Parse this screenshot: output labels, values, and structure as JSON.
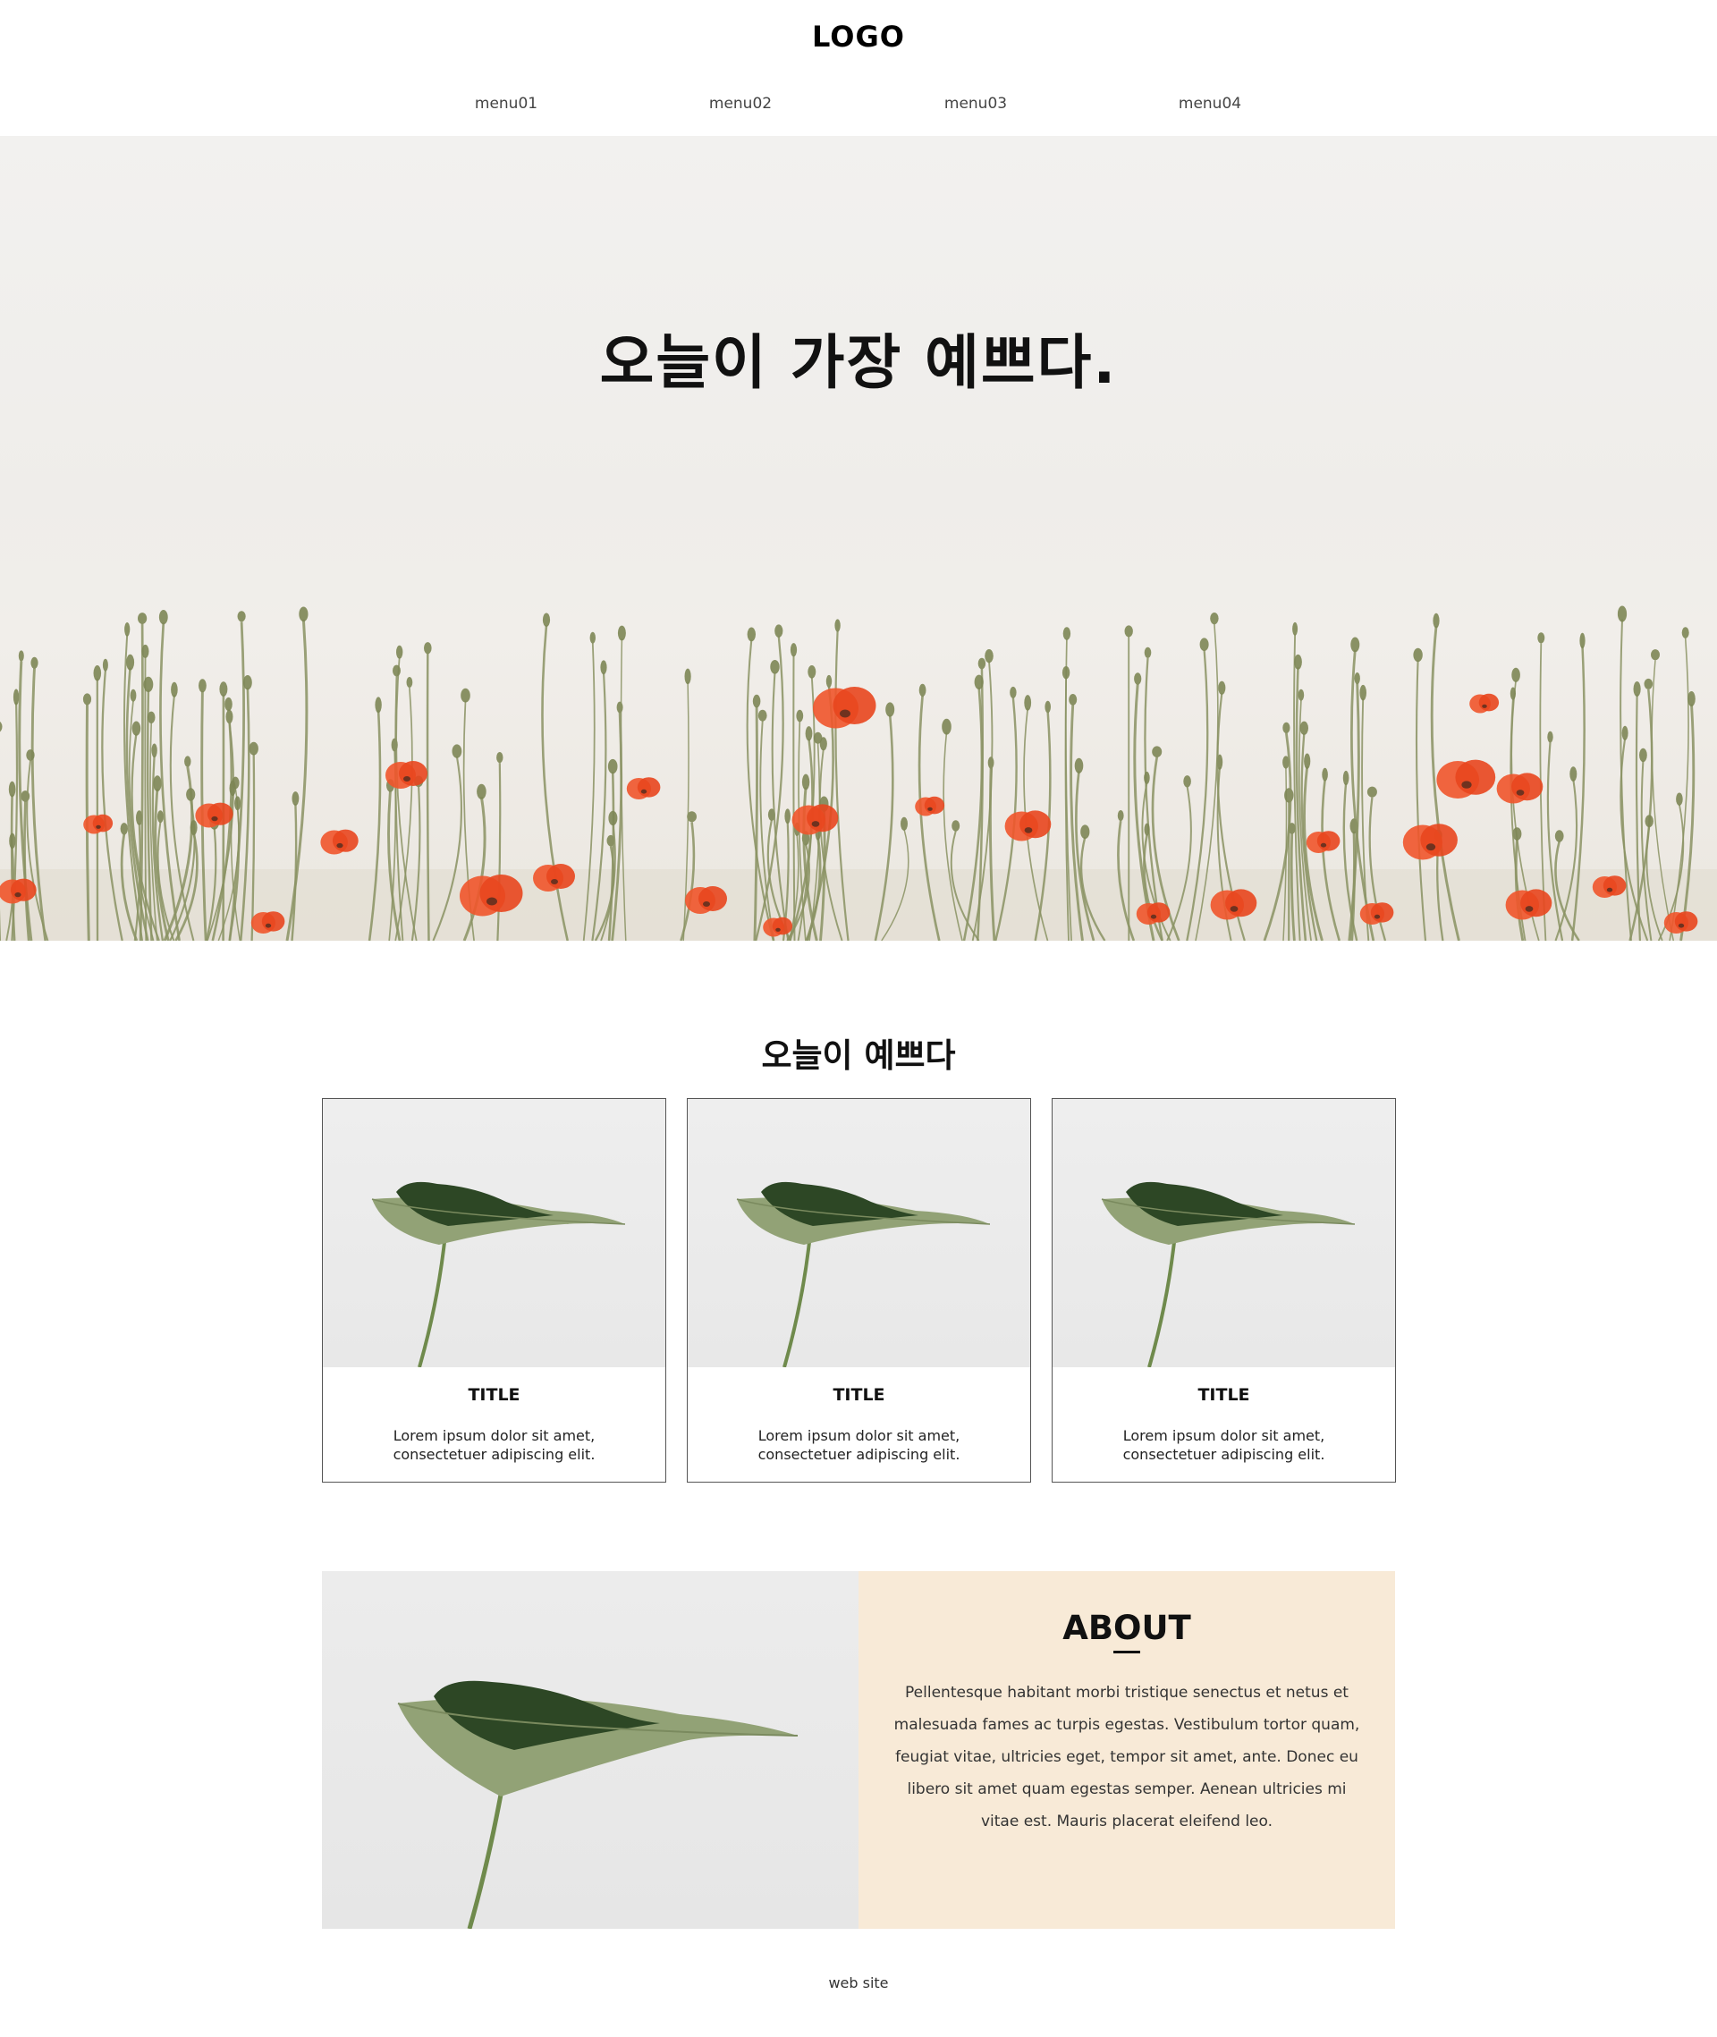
{
  "header": {
    "logo": "LOGO",
    "menu": [
      {
        "label": "menu01"
      },
      {
        "label": "menu02"
      },
      {
        "label": "menu03"
      },
      {
        "label": "menu04"
      }
    ]
  },
  "hero": {
    "title": "오늘이 가장 예쁘다."
  },
  "cards_section": {
    "title": "오늘이 예쁘다",
    "cards": [
      {
        "title": "TITLE",
        "text": "Lorem ipsum dolor sit amet, consectetuer adipiscing elit."
      },
      {
        "title": "TITLE",
        "text": "Lorem ipsum dolor sit amet, consectetuer adipiscing elit."
      },
      {
        "title": "TITLE",
        "text": "Lorem ipsum dolor sit amet, consectetuer adipiscing elit."
      }
    ]
  },
  "about": {
    "title": "ABOUT",
    "text": "Pellentesque habitant morbi tristique senectus et netus et malesuada fames ac turpis egestas. Vestibulum tortor quam, feugiat vitae, ultricies eget, tempor sit amet, ante. Donec eu libero sit amet quam egestas semper. Aenean ultricies mi vitae est. Mauris placerat eleifend leo."
  },
  "footer": {
    "text": "web site"
  },
  "colors": {
    "about_background": "#f8ead7",
    "poppy": "#f0552b",
    "stem": "#8a9263",
    "leaf_dark": "#2f4a26",
    "leaf_light": "#8f9f72"
  }
}
